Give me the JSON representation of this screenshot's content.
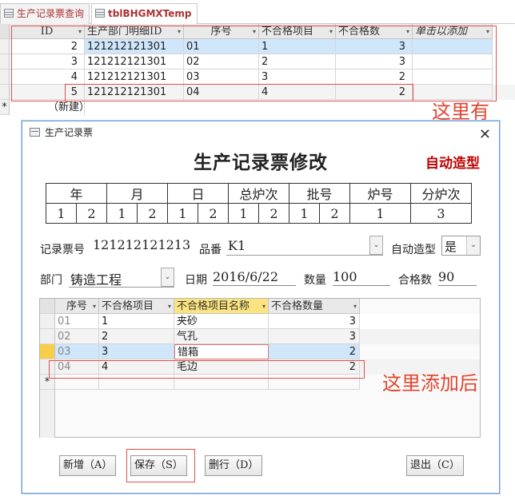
{
  "tabs": [
    {
      "label": "生产记录票查询"
    },
    {
      "label": "tblBHGMXTemp"
    }
  ],
  "datasheet": {
    "columns": [
      "ID",
      "生产部门明细ID",
      "序号",
      "不合格项目",
      "不合格数",
      "单击以添加"
    ],
    "rows": [
      {
        "id": "2",
        "dept": "121212121301",
        "seq": "01",
        "item": "1",
        "count": "3"
      },
      {
        "id": "3",
        "dept": "121212121301",
        "seq": "02",
        "item": "2",
        "count": "3"
      },
      {
        "id": "4",
        "dept": "121212121301",
        "seq": "03",
        "item": "3",
        "count": "2"
      },
      {
        "id": "5",
        "dept": "121212121301",
        "seq": "04",
        "item": "4",
        "count": "2"
      }
    ],
    "new_row_label": "（新建）",
    "new_row_marker": "*"
  },
  "annotations": {
    "here_is": "这里有",
    "after_add": "这里添加后"
  },
  "dialog": {
    "window_title": "生产记录票",
    "heading": "生产记录票修改",
    "auto_tag": "自动造型",
    "grid_headers": [
      "年",
      "月",
      "日",
      "总炉次",
      "批号",
      "炉号",
      "分炉次"
    ],
    "grid_values": [
      "1",
      "2",
      "1",
      "2",
      "1",
      "2",
      "1",
      "2",
      "1",
      "2",
      "1",
      "3"
    ],
    "record_no_label": "记录票号",
    "record_no": "121212121213",
    "part_label": "品番",
    "part_value": "K1",
    "auto_mold_label": "自动造型",
    "auto_mold_value": "是",
    "dept_label": "部门",
    "dept_value": "铸造工程",
    "date_label": "日期",
    "date_value": "2016/6/22",
    "qty_label": "数量",
    "qty_value": "100",
    "pass_label": "合格数",
    "pass_value": "90",
    "subgrid": {
      "columns": [
        "序号",
        "不合格项目",
        "不合格项目名称",
        "不合格数量"
      ],
      "rows": [
        {
          "seq": "01",
          "item": "1",
          "name": "夹砂",
          "count": "3"
        },
        {
          "seq": "02",
          "item": "2",
          "name": "气孔",
          "count": "3"
        },
        {
          "seq": "03",
          "item": "3",
          "name": "错箱",
          "count": "2"
        },
        {
          "seq": "04",
          "item": "4",
          "name": "毛边",
          "count": "2"
        }
      ],
      "new_marker": "*"
    },
    "buttons": {
      "add": "新增（A）",
      "save": "保存（S）",
      "delete": "删行（D）",
      "exit": "退出（C）"
    }
  }
}
